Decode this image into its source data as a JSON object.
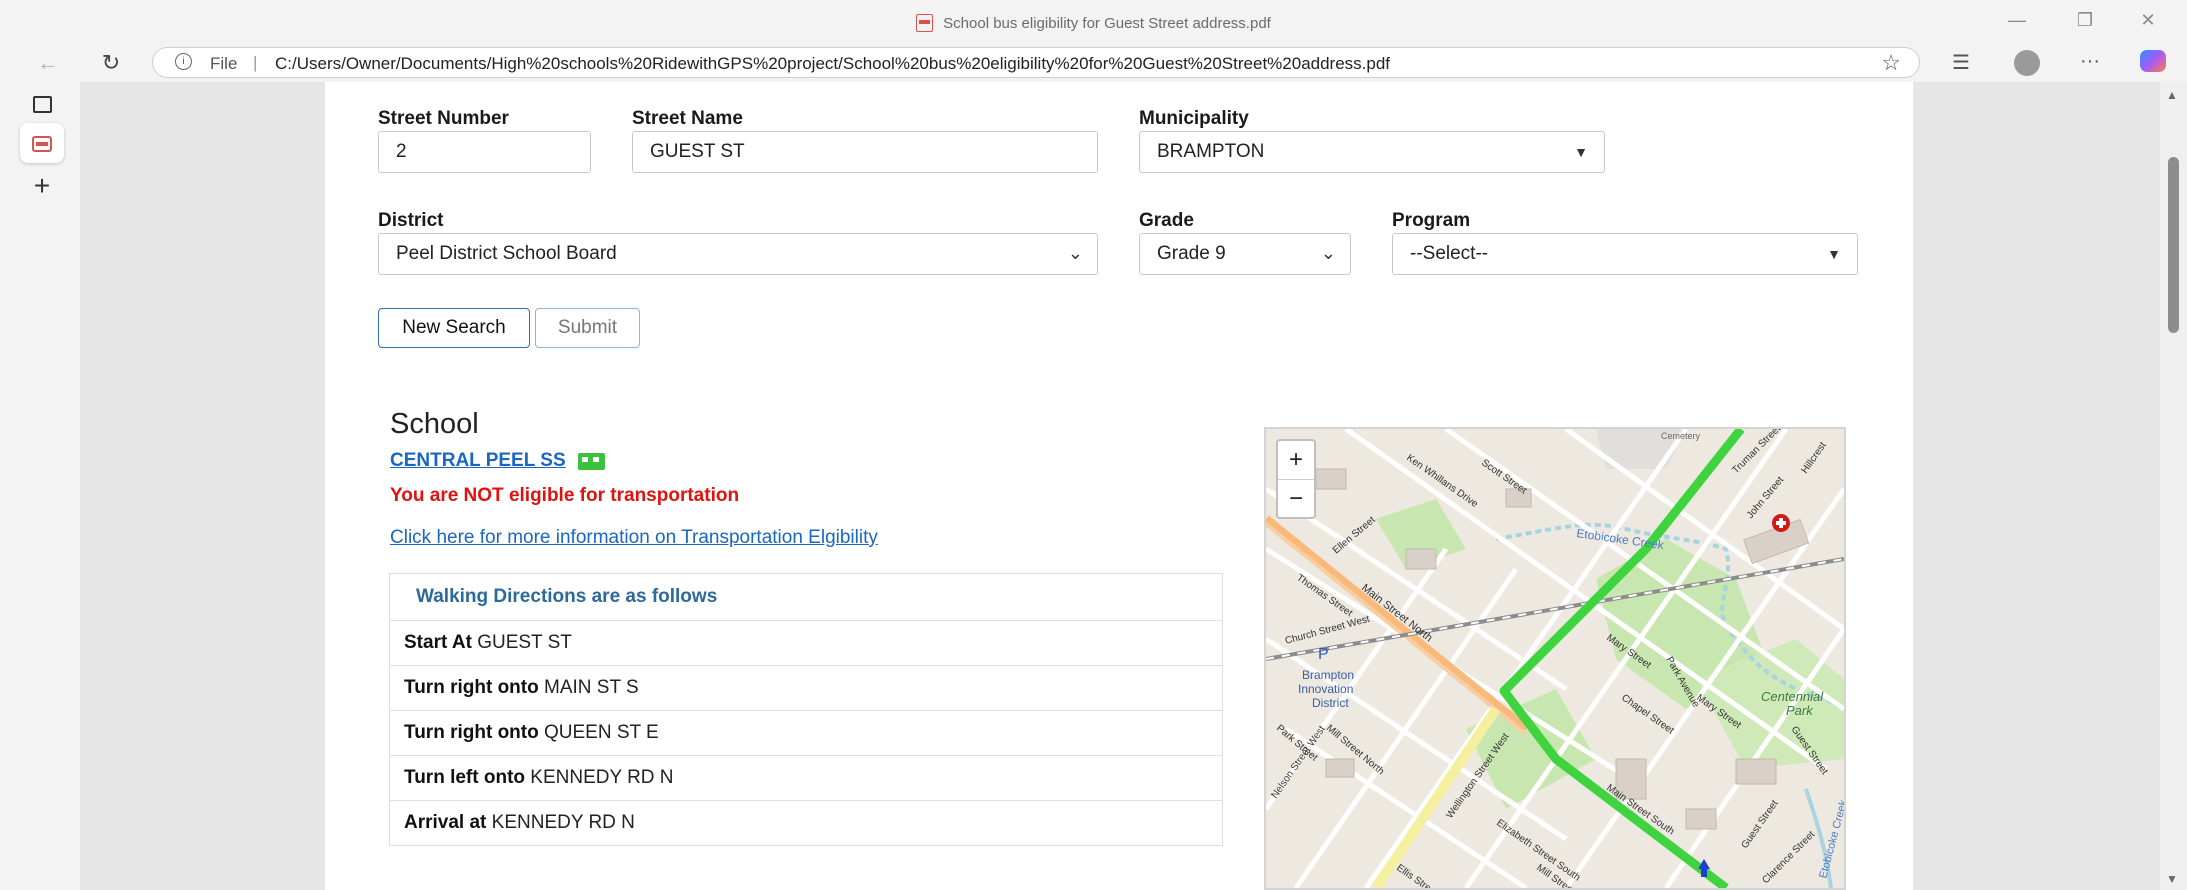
{
  "window": {
    "title": "School bus eligibility for Guest Street address.pdf"
  },
  "addressbar": {
    "file_label": "File",
    "separator": "|",
    "url": "C:/Users/Owner/Documents/High%20schools%20RidewithGPS%20project/School%20bus%20eligibility%20for%20Guest%20Street%20address.pdf"
  },
  "toolbar": {
    "more_label": "···"
  },
  "sidebar": {
    "add_label": "+"
  },
  "form": {
    "street_number_label": "Street Number",
    "street_number_value": "2",
    "street_name_label": "Street Name",
    "street_name_value": "GUEST ST",
    "municipality_label": "Municipality",
    "municipality_value": "BRAMPTON",
    "district_label": "District",
    "district_value": "Peel District School Board",
    "grade_label": "Grade",
    "grade_value": "Grade 9",
    "program_label": "Program",
    "program_value": "--Select--",
    "new_search_label": "New Search",
    "submit_label": "Submit"
  },
  "result": {
    "heading": "School",
    "school_name": "CENTRAL PEEL SS",
    "eligibility_message": "You are NOT eligible for transportation",
    "info_link": "Click here for more information on Transportation Elgibility",
    "directions_header": "Walking Directions are as follows",
    "directions": [
      {
        "action": "Start At",
        "street": "GUEST ST"
      },
      {
        "action": "Turn right onto",
        "street": "MAIN ST S"
      },
      {
        "action": "Turn right onto",
        "street": "QUEEN ST E"
      },
      {
        "action": "Turn left onto",
        "street": "KENNEDY RD N"
      },
      {
        "action": "Arrival at",
        "street": "KENNEDY RD N"
      }
    ]
  },
  "map": {
    "zoom_in_label": "+",
    "zoom_out_label": "−",
    "labels": {
      "street_1": "Ken Whillans Drive",
      "street_2": "Scott Street",
      "street_3": "Truman Street",
      "street_4": "Hillcrest",
      "street_5": "John Street",
      "street_6": "Ellen Street",
      "street_7": "Thomas Street",
      "street_8": "Main Street North",
      "street_9": "Church Street West",
      "street_10": "Mary Street",
      "street_11": "Park Avenue",
      "street_12": "Chapel Street",
      "street_13": "Mary Street",
      "street_14": "Guest Street",
      "street_15": "Park Street",
      "street_16": "Mill Street North",
      "street_17": "Nelson Street West",
      "street_18": "Wellington Street West",
      "street_19": "Elizabeth Street South",
      "street_20": "Main Street South",
      "street_21": "Guest Street",
      "street_22": "Clarence Street",
      "street_23": "Ellis Street",
      "street_24": "Mill Street",
      "creek_1": "Etobicoke Creek",
      "creek_2": "Etobicoke Creek",
      "district_1": "Brampton",
      "district_2": "Innovation",
      "district_3": "District",
      "park_1": "Centennial",
      "park_2": "Park",
      "parking": "P",
      "cemetery": "Cemetery"
    },
    "colors": {
      "route": "#3fd43f",
      "water": "#aad3df",
      "park": "#c8e6b0"
    }
  }
}
